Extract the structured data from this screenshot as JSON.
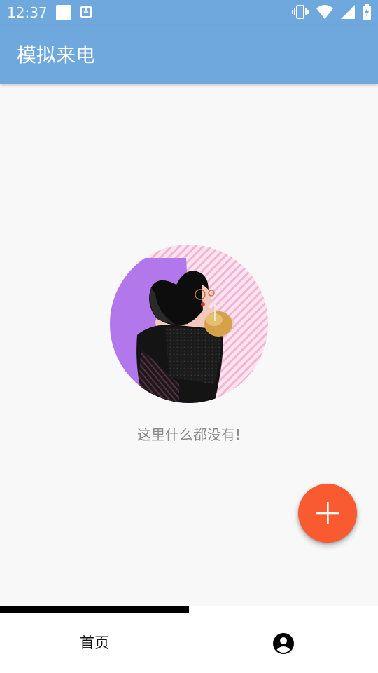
{
  "status_bar": {
    "time": "12:37",
    "notification_a_label": "A",
    "icons": [
      "vibrate-icon",
      "wifi-icon",
      "signal-icon",
      "battery-charging-icon"
    ]
  },
  "app_bar": {
    "title": "模拟来电"
  },
  "main": {
    "empty_message": "这里什么都没有!",
    "illustration": "woman-drinking-illustration"
  },
  "fab": {
    "icon": "plus-icon",
    "color": "#fa5a2f"
  },
  "bottom_nav": {
    "tabs": [
      {
        "label": "首页",
        "selected": true
      },
      {
        "icon": "account-circle-icon",
        "selected": false
      }
    ]
  },
  "colors": {
    "primary": "#6fa8dc",
    "accent": "#fa5a2f"
  }
}
